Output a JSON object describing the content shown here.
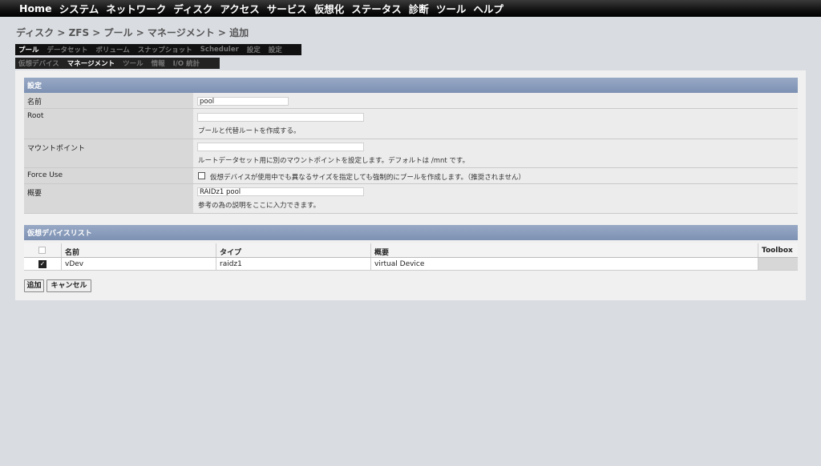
{
  "nav": {
    "items": [
      "Home",
      "システム",
      "ネットワーク",
      "ディスク",
      "アクセス",
      "サービス",
      "仮想化",
      "ステータス",
      "診断",
      "ツール",
      "ヘルプ"
    ]
  },
  "breadcrumb": "ディスク > ZFS > プール > マネージメント > 追加",
  "tabs1": [
    "プール",
    "データセット",
    "ボリューム",
    "スナップショット",
    "Scheduler",
    "設定",
    "設定"
  ],
  "tabs2": [
    "仮想デバイス",
    "マネージメント",
    "ツール",
    "情報",
    "I/O 統計"
  ],
  "settings": {
    "header": "設定",
    "name_label": "名前",
    "name_value": "pool",
    "root_label": "Root",
    "root_value": "",
    "root_hint": "プールと代替ルートを作成する。",
    "mount_label": "マウントポイント",
    "mount_value": "",
    "mount_hint": "ルートデータセット用に別のマウントポイントを設定します。デフォルトは /mnt です。",
    "force_label": "Force Use",
    "force_text": "仮想デバイスが使用中でも異なるサイズを指定しても強制的にプールを作成します。（推奨されません）",
    "force_checked": false,
    "desc_label": "概要",
    "desc_value": "RAIDz1 pool",
    "desc_hint": "参考の為の説明をここに入力できます。"
  },
  "vdev": {
    "header": "仮想デバイスリスト",
    "columns": [
      "名前",
      "タイプ",
      "概要",
      "Toolbox"
    ],
    "rows": [
      {
        "checked": true,
        "name": "vDev",
        "type": "raidz1",
        "desc": "virtual Device"
      }
    ]
  },
  "buttons": {
    "add": "追加",
    "cancel": "キャンセル"
  }
}
